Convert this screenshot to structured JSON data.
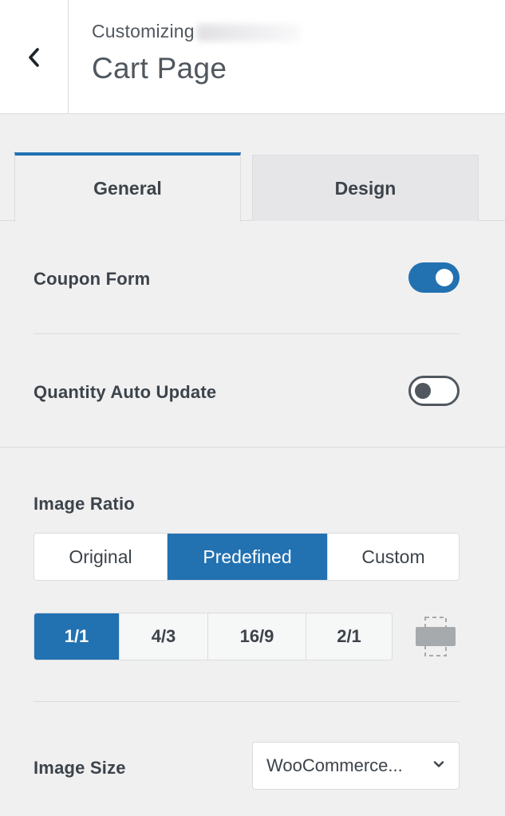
{
  "header": {
    "subtitle": "Customizing",
    "title": "Cart Page"
  },
  "tabs": [
    {
      "label": "General",
      "active": true
    },
    {
      "label": "Design",
      "active": false
    }
  ],
  "settings": {
    "coupon_form": {
      "label": "Coupon Form",
      "enabled": true
    },
    "quantity_auto_update": {
      "label": "Quantity Auto Update",
      "enabled": false
    },
    "image_ratio": {
      "label": "Image Ratio",
      "modes": [
        "Original",
        "Predefined",
        "Custom"
      ],
      "selected_mode": "Predefined",
      "ratios": [
        "1/1",
        "4/3",
        "16/9",
        "2/1"
      ],
      "selected_ratio": "1/1"
    },
    "image_size": {
      "label": "Image Size",
      "value": "WooCommerce..."
    }
  },
  "colors": {
    "accent": "#2271b1",
    "background": "#f0f0f1",
    "text": "#3c434a"
  },
  "icons": {
    "back": "chevron-left-icon",
    "orientation": "landscape-orientation-icon",
    "select_arrow": "chevron-down-icon"
  }
}
